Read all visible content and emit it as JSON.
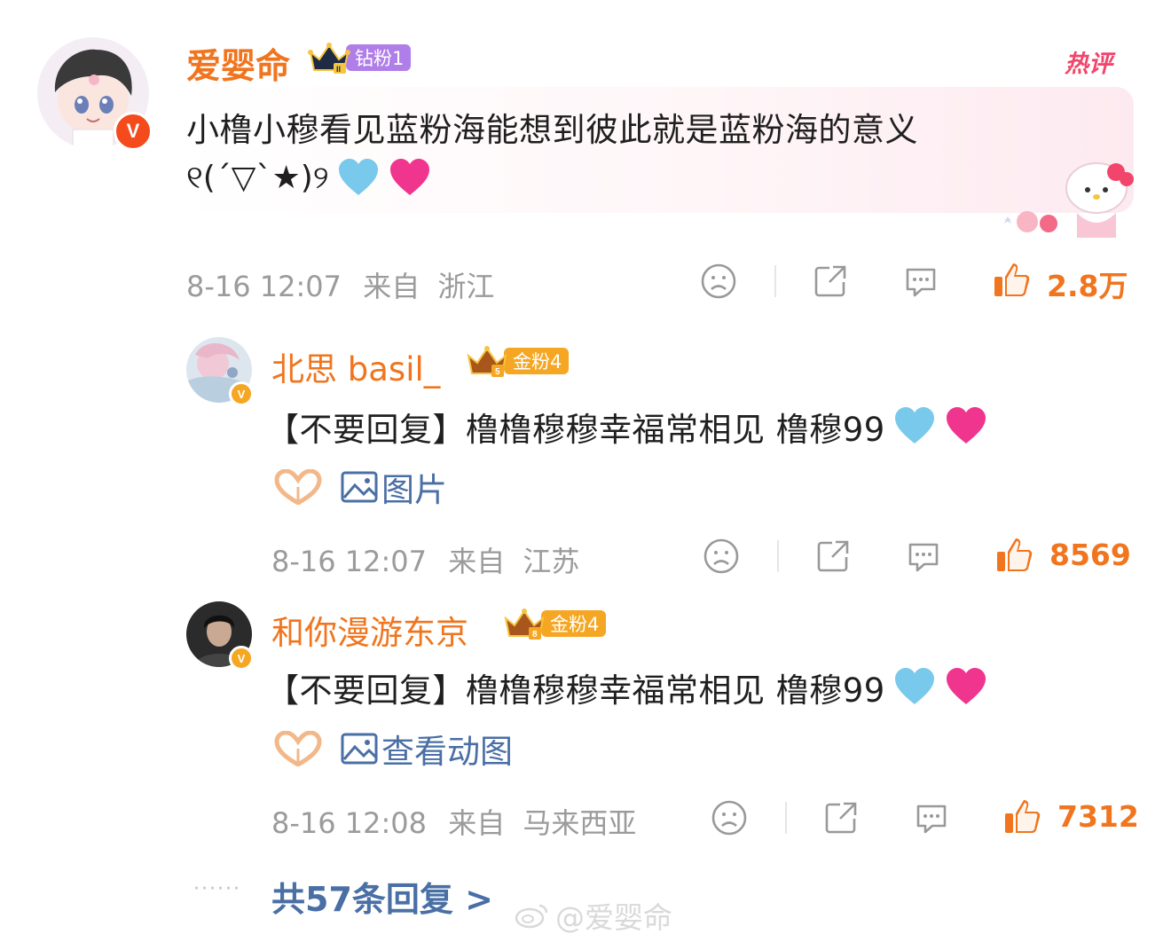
{
  "hot_label": "热评",
  "main_comment": {
    "username": "爱婴命",
    "fan_badge": {
      "level_label": "钻粉1",
      "color": "#b07ee8"
    },
    "text_line1": "小橹小穆看见蓝粉海能想到彼此就是蓝粉海的意义",
    "text_line2": "୧(´▽`★)୨",
    "emoji": [
      "light-blue-heart",
      "pink-heart"
    ],
    "time": "8-16 12:07",
    "from_label": "来自",
    "location": "浙江",
    "likes": "2.8万"
  },
  "replies": [
    {
      "username": "北思 basil_",
      "fan_badge": {
        "level_label": "金粉4",
        "color": "#f5a623"
      },
      "text": "【不要回复】橹橹穆穆幸福常相见 橹穆99",
      "attachment_label": "图片",
      "time": "8-16 12:07",
      "from_label": "来自",
      "location": "江苏",
      "likes": "8569"
    },
    {
      "username": "和你漫游东京",
      "fan_badge": {
        "level_label": "金粉4",
        "color": "#f5a623"
      },
      "text": "【不要回复】橹橹穆穆幸福常相见 橹穆99",
      "attachment_label": "查看动图",
      "time": "8-16 12:08",
      "from_label": "来自",
      "location": "马来西亚",
      "likes": "7312"
    }
  ],
  "more_replies_label": "共57条回复 >",
  "watermark": "@爱婴命",
  "colors": {
    "accent": "#f0751e",
    "link": "#4a6fa5",
    "meta": "#9b9b9b"
  }
}
